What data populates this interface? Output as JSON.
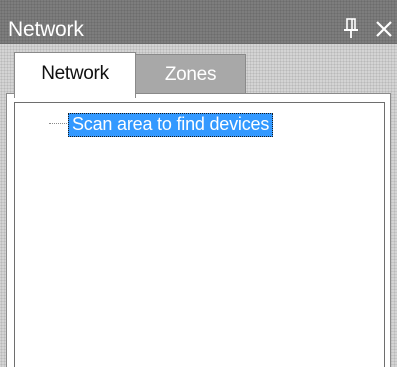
{
  "panel": {
    "title": "Network",
    "pin_icon": "pin-icon",
    "close_icon": "close-icon"
  },
  "tabs": [
    {
      "label": "Network",
      "selected": true
    },
    {
      "label": "Zones",
      "selected": false
    }
  ],
  "tree": {
    "items": [
      {
        "label": "Scan area to find devices",
        "selected": true
      }
    ]
  },
  "colors": {
    "title_bar": "#7d7d7d",
    "selection": "#3399ff",
    "inactive_tab": "#a8a8a8"
  }
}
